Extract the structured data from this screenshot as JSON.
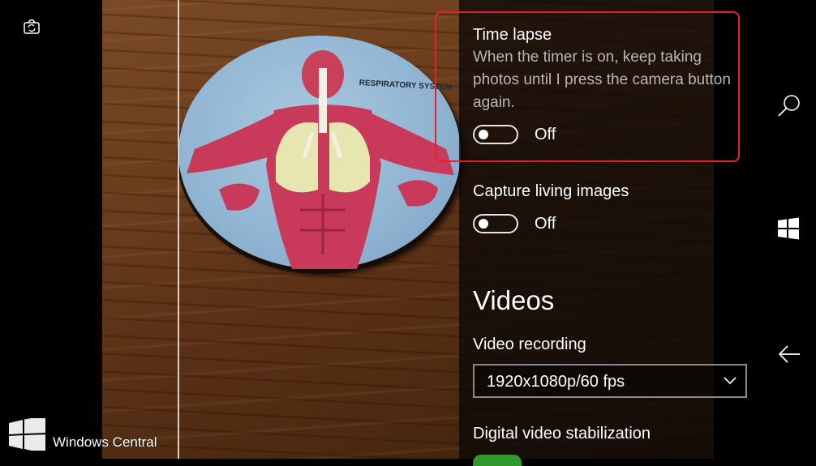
{
  "settings": {
    "time_lapse": {
      "title": "Time lapse",
      "description": "When the timer is on, keep taking photos until I press the camera button again.",
      "state": "Off"
    },
    "living_images": {
      "title": "Capture living images",
      "state": "Off"
    },
    "videos_heading": "Videos",
    "video_recording": {
      "title": "Video recording",
      "value": "1920x1080p/60 fps"
    },
    "stabilization": {
      "title": "Digital video stabilization"
    }
  },
  "viewfinder": {
    "poster_text": "RESPIRATORY SYSTEM"
  },
  "watermark": {
    "text": "Windows Central"
  },
  "icons": {
    "camera_switch": "camera-switch-icon",
    "search": "search-icon",
    "start": "windows-logo-icon",
    "back": "back-arrow-icon"
  },
  "colors": {
    "highlight": "#e8202a",
    "toggle_on": "#2f9a2a"
  }
}
